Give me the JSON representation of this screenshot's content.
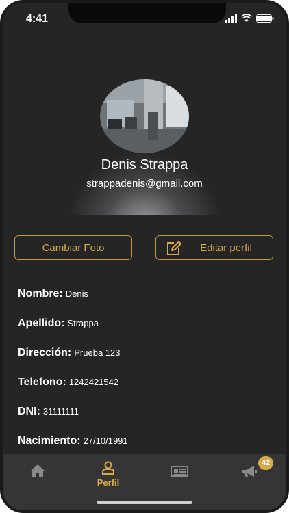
{
  "status_bar": {
    "time": "4:41"
  },
  "profile": {
    "name": "Denis Strappa",
    "email": "strappadenis@gmail.com"
  },
  "actions": {
    "change_photo": "Cambiar Foto",
    "edit_profile": "Editar perfil"
  },
  "fields": [
    {
      "label": "Nombre:",
      "value": "Denis"
    },
    {
      "label": "Apellido:",
      "value": "Strappa"
    },
    {
      "label": "Dirección:",
      "value": "Prueba 123"
    },
    {
      "label": "Telefono:",
      "value": "1242421542"
    },
    {
      "label": "DNI:",
      "value": "31111111"
    },
    {
      "label": "Nacimiento:",
      "value": "27/10/1991"
    }
  ],
  "tabbar": {
    "items": [
      {
        "icon": "home-icon",
        "label": ""
      },
      {
        "icon": "user-icon",
        "label": "Perfil",
        "active": true
      },
      {
        "icon": "news-icon",
        "label": ""
      },
      {
        "icon": "megaphone-icon",
        "label": ""
      }
    ],
    "badge": "42"
  },
  "colors": {
    "accent": "#d8a94a",
    "background": "#252525",
    "tabbar": "#353535",
    "inactive_icon": "#8a8a8a"
  }
}
